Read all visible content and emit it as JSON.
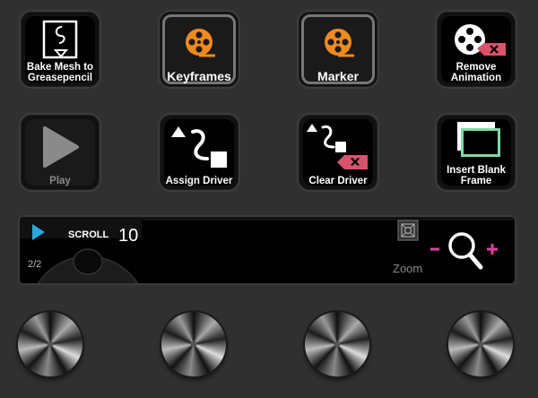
{
  "keys": [
    {
      "label": "Bake Mesh to Greasepencil",
      "icon": "grease-pencil-icon"
    },
    {
      "label": "Keyframes",
      "icon": "film-reel-icon"
    },
    {
      "label": "Marker",
      "icon": "film-reel-icon"
    },
    {
      "label": "Remove Animation",
      "icon": "film-reel-remove-icon"
    },
    {
      "label": "Play",
      "icon": "play-icon"
    },
    {
      "label": "Assign Driver",
      "icon": "driver-icon"
    },
    {
      "label": "Clear Driver",
      "icon": "driver-clear-icon"
    },
    {
      "label": "Insert Blank Frame",
      "icon": "blank-frame-icon"
    }
  ],
  "dial": {
    "name": "SCROLL",
    "value": "10",
    "page": "2/2",
    "zoom_label": "Zoom",
    "zoom_minus": "−",
    "zoom_plus": "+"
  },
  "colors": {
    "accent_orange": "#f08a1e",
    "remove_red": "#d9536a",
    "play_blue": "#29a8e0",
    "zoom_pink": "#e040a0",
    "frame_green": "#7fd9a8"
  }
}
